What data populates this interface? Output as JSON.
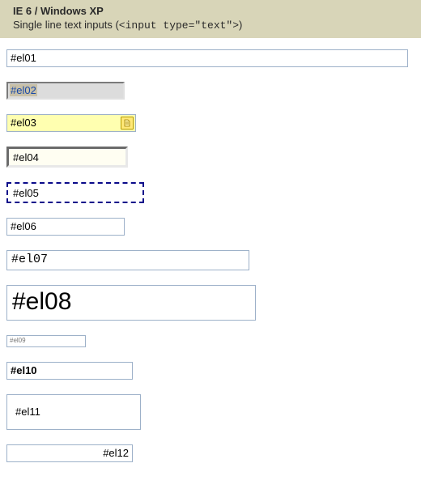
{
  "header": {
    "title": "IE 6 / Windows XP",
    "subtitle_prefix": "Single line text inputs (",
    "subtitle_code": "<input type=\"text\">",
    "subtitle_suffix": ")"
  },
  "inputs": {
    "el01": {
      "value": "#el01"
    },
    "el02": {
      "value": "#el02"
    },
    "el03": {
      "value": "#el03"
    },
    "el04": {
      "value": "#el04"
    },
    "el05": {
      "value": "#el05"
    },
    "el06": {
      "value": "#el06"
    },
    "el07": {
      "value": "#el07"
    },
    "el08": {
      "value": "#el08"
    },
    "el09": {
      "value": "#el09"
    },
    "el10": {
      "value": "#el10"
    },
    "el11": {
      "value": "#el11"
    },
    "el12": {
      "value": "#el12"
    }
  },
  "icons": {
    "autofill": "autofill-icon"
  }
}
